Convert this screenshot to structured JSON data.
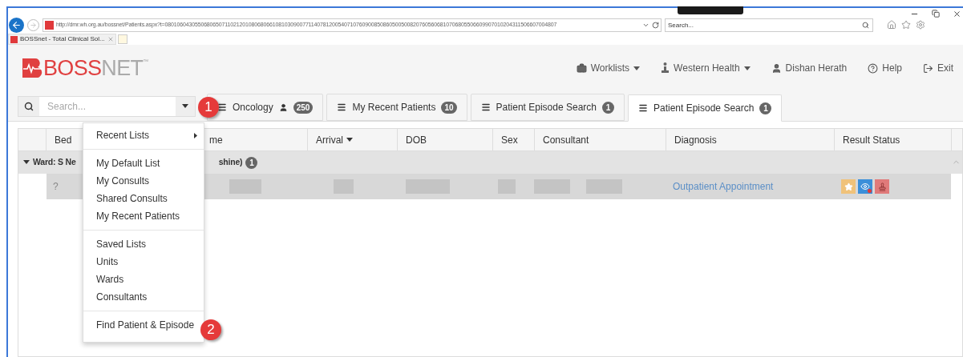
{
  "browser": {
    "url": "http://dmr.wh.org.au/bossnet/Patients.aspx?t=08010604305506806507110212010806806610810309007711407812005407107609008508605005008207605606810706805506609907010204311506607004807",
    "search_placeholder": "Search...",
    "tab_title": "BOSSnet - Total Clinical Sol..."
  },
  "app": {
    "logo": {
      "first": "BOSS",
      "second": "NET",
      "mark": "™"
    },
    "nav": [
      {
        "label": "Worklists",
        "kind": "briefcase",
        "dropdown": true
      },
      {
        "label": "Western Health",
        "kind": "hospital",
        "dropdown": true
      },
      {
        "label": "Dishan Herath",
        "kind": "user",
        "dropdown": false
      },
      {
        "label": "Help",
        "kind": "help",
        "dropdown": false
      },
      {
        "label": "Exit",
        "kind": "exit",
        "dropdown": false
      }
    ],
    "search": {
      "placeholder": "Search..."
    },
    "tabs": [
      {
        "label": "Oncology",
        "count": "250",
        "people": true,
        "selected": false
      },
      {
        "label": "My Recent Patients",
        "count": "10",
        "people": false,
        "selected": false
      },
      {
        "label": "Patient Episode Search",
        "count": "1",
        "people": false,
        "selected": false
      },
      {
        "label": "Patient Episode Search",
        "count": "1",
        "people": false,
        "selected": true
      }
    ],
    "table": {
      "columns": [
        {
          "label": "Bed",
          "sorted": false
        },
        {
          "label": "me",
          "sorted": false
        },
        {
          "label": "Arrival",
          "sorted": true
        },
        {
          "label": "DOB",
          "sorted": false
        },
        {
          "label": "Sex",
          "sorted": false
        },
        {
          "label": "Consultant",
          "sorted": false
        },
        {
          "label": "Diagnosis",
          "sorted": false
        },
        {
          "label": "Result Status",
          "sorted": false
        }
      ],
      "group": {
        "label_start": "Ward: S Ne",
        "label_end": "shine)",
        "count": "1",
        "expanded": true
      },
      "rows": [
        {
          "bed": "?",
          "diagnosis": "Outpatient Appointment",
          "flags": [
            {
              "kind": "star"
            },
            {
              "kind": "eye"
            },
            {
              "kind": "stamp"
            }
          ]
        }
      ]
    },
    "menu": {
      "sections": [
        [
          {
            "label": "Recent Lists",
            "submenu": true
          }
        ],
        [
          {
            "label": "My Default List",
            "submenu": false
          },
          {
            "label": "My Consults",
            "submenu": false
          },
          {
            "label": "Shared Consults",
            "submenu": false
          },
          {
            "label": "My Recent Patients",
            "submenu": false
          }
        ],
        [
          {
            "label": "Saved Lists",
            "submenu": false
          },
          {
            "label": "Units",
            "submenu": false
          },
          {
            "label": "Wards",
            "submenu": false
          },
          {
            "label": "Consultants",
            "submenu": false
          }
        ],
        [
          {
            "label": "Find Patient & Episode",
            "submenu": false
          }
        ]
      ]
    },
    "callouts": [
      "1",
      "2"
    ]
  }
}
